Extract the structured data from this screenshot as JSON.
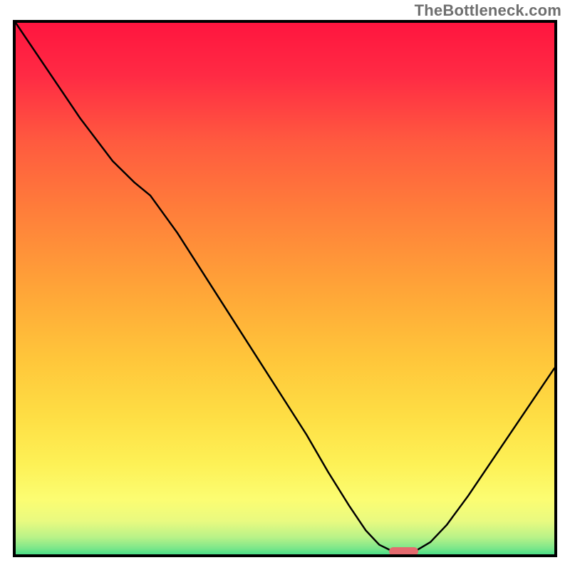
{
  "watermark": "TheBottleneck.com",
  "colors": {
    "curve": "#000000",
    "marker": "#e46a6e",
    "border": "#000000"
  },
  "chart_data": {
    "type": "line",
    "title": "",
    "xlabel": "",
    "ylabel": "",
    "xlim": [
      0,
      100
    ],
    "ylim": [
      0,
      100
    ],
    "grid": false,
    "curve_points": [
      {
        "x": 0.0,
        "y": 100.0
      },
      {
        "x": 6.0,
        "y": 91.0
      },
      {
        "x": 12.0,
        "y": 82.0
      },
      {
        "x": 18.0,
        "y": 74.0
      },
      {
        "x": 22.0,
        "y": 70.0
      },
      {
        "x": 25.0,
        "y": 67.5
      },
      {
        "x": 30.0,
        "y": 60.5
      },
      {
        "x": 36.0,
        "y": 51.0
      },
      {
        "x": 42.0,
        "y": 41.5
      },
      {
        "x": 48.0,
        "y": 32.0
      },
      {
        "x": 54.0,
        "y": 22.5
      },
      {
        "x": 58.0,
        "y": 15.5
      },
      {
        "x": 62.0,
        "y": 9.0
      },
      {
        "x": 65.0,
        "y": 4.5
      },
      {
        "x": 67.5,
        "y": 1.8
      },
      {
        "x": 69.5,
        "y": 0.8
      },
      {
        "x": 72.0,
        "y": 0.5
      },
      {
        "x": 74.5,
        "y": 0.8
      },
      {
        "x": 77.0,
        "y": 2.3
      },
      {
        "x": 80.0,
        "y": 5.5
      },
      {
        "x": 84.0,
        "y": 11.0
      },
      {
        "x": 88.0,
        "y": 17.0
      },
      {
        "x": 92.0,
        "y": 23.0
      },
      {
        "x": 96.0,
        "y": 29.0
      },
      {
        "x": 100.0,
        "y": 35.0
      }
    ],
    "marker": {
      "x_center": 72.0,
      "y": 0.5,
      "width": 5.5,
      "height": 1.6
    }
  }
}
